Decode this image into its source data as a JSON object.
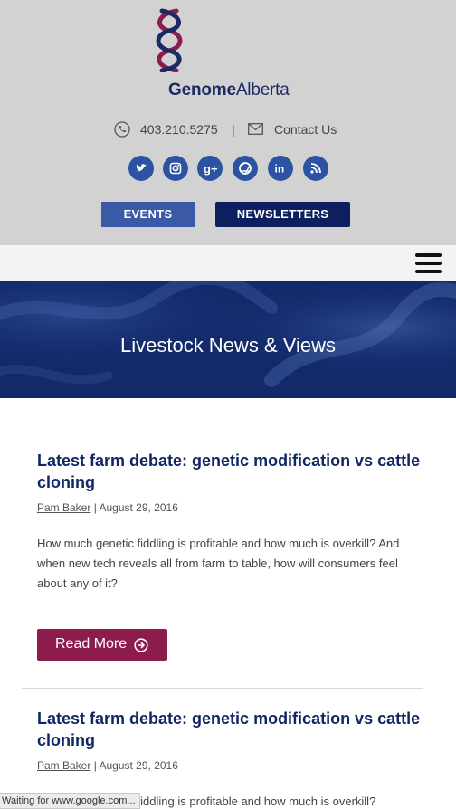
{
  "header": {
    "logo": {
      "brand_bold": "Genome",
      "brand_light": "Alberta"
    },
    "phone": "403.210.5275",
    "separator": "|",
    "contact_label": "Contact Us",
    "social_icons": [
      "twitter-icon",
      "instagram-icon",
      "google-plus-icon",
      "flickr-icon",
      "linkedin-icon",
      "rss-icon"
    ],
    "buttons": {
      "events": "EVENTS",
      "newsletters": "NEWSLETTERS"
    }
  },
  "banner": {
    "title": "Livestock News & Views"
  },
  "articles": [
    {
      "title": "Latest farm debate: genetic modification vs cattle cloning",
      "author": "Pam Baker",
      "date": "| August 29, 2016",
      "excerpt": "How much genetic fiddling is profitable and how much is overkill? And when new tech reveals all from farm to table, how will consumers feel about any of it?",
      "read_more": "Read More"
    },
    {
      "title": "Latest farm debate: genetic modification vs cattle cloning",
      "author": "Pam Baker",
      "date": "| August 29, 2016",
      "excerpt": "How much genetic fiddling is profitable and how much is overkill?"
    }
  ],
  "status_bar": {
    "text": "Waiting for www.google.com..."
  },
  "colors": {
    "header_bg": "#d2d2d2",
    "brand_navy": "#102766",
    "social_blue": "#2c52a2",
    "events_blue": "#3a5aa6",
    "newsletters_navy": "#0d1f5e",
    "read_more_maroon": "#8b1c4b",
    "logo_maroon": "#8b1c4b"
  }
}
